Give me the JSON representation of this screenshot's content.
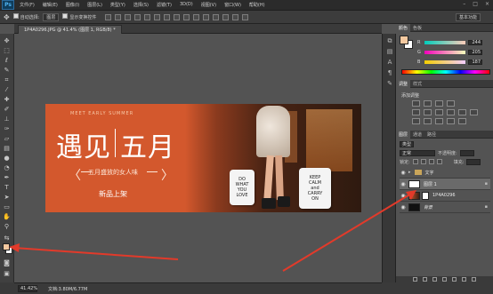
{
  "app": {
    "logo": "Ps"
  },
  "menu": [
    "文件(F)",
    "编辑(E)",
    "图像(I)",
    "图层(L)",
    "类型(Y)",
    "选择(S)",
    "滤镜(T)",
    "3D(D)",
    "视图(V)",
    "窗口(W)",
    "帮助(H)"
  ],
  "window_controls": [
    "–",
    "□",
    "×"
  ],
  "options": {
    "auto_select_label": "自动选择:",
    "auto_select_value": "图层",
    "transform_label": "显示变换控件",
    "workspace": "基本功能"
  },
  "document": {
    "tab_title": "1P4A0296.JPG @ 41.4% (图层 1, RGB/8) *"
  },
  "artwork": {
    "tagline_en": "MEET EARLY SUMMER",
    "headline_a": "遇见",
    "headline_b": "五月",
    "subtitle": "五月盛放的女人味",
    "chevron_left": "〈",
    "chevron_right": "〉",
    "new_arrivals": "新品上架",
    "pillow_a": [
      "DO",
      "WHAT",
      "YOU",
      "LOVE"
    ],
    "pillow_b": [
      "KEEP",
      "CALM",
      "and",
      "CARRY",
      "ON"
    ]
  },
  "panels": {
    "color_tabs": [
      "颜色",
      "色板"
    ],
    "color": {
      "foreground": "#f4c9a0",
      "background": "#ffffff",
      "channels": [
        {
          "ch": "R",
          "value": "244"
        },
        {
          "ch": "G",
          "value": "205"
        },
        {
          "ch": "B",
          "value": "187"
        }
      ]
    },
    "adjust_tabs": [
      "调整",
      "样式"
    ],
    "adjust_title": "添加调整",
    "layers_tabs": [
      "图层",
      "通道",
      "路径"
    ],
    "layers": {
      "kind_label": "类型",
      "blend_mode": "正常",
      "opacity_label": "不透明度:",
      "lock_label": "锁定:",
      "fill_label": "填充:",
      "items": [
        {
          "name": "文字",
          "kind": "folder"
        },
        {
          "name": "图层 1",
          "kind": "white"
        },
        {
          "name": "1P4A0296",
          "kind": "photo"
        },
        {
          "name": "背景",
          "kind": "dark"
        }
      ]
    }
  },
  "status": {
    "zoom": "41.42%",
    "doc": "文档:3.80M/6.77M"
  }
}
